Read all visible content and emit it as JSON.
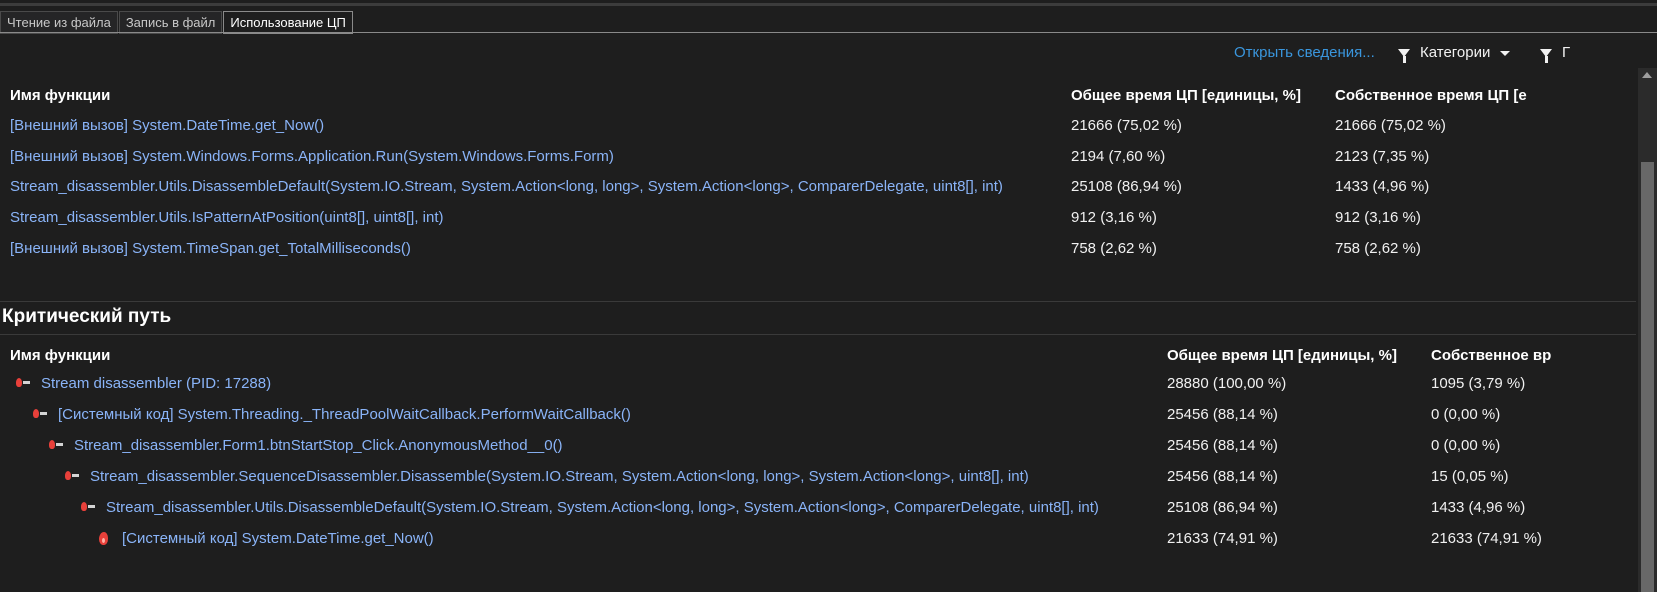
{
  "tabs": [
    {
      "label": "Чтение из файла"
    },
    {
      "label": "Запись в файл"
    },
    {
      "label": "Использование ЦП"
    }
  ],
  "toolbar": {
    "open_details": "Открыть сведения...",
    "categories": "Категории",
    "filter_partial": "Г"
  },
  "hot_functions": {
    "headers": [
      "Имя функции",
      "Общее время ЦП [единицы, %]",
      "Собственное время ЦП [е"
    ],
    "rows": [
      {
        "name": "[Внешний вызов] System.DateTime.get_Now()",
        "total": "21666 (75,02 %)",
        "self": "21666 (75,02 %)"
      },
      {
        "name": "[Внешний вызов] System.Windows.Forms.Application.Run(System.Windows.Forms.Form)",
        "total": "2194 (7,60 %)",
        "self": "2123 (7,35 %)"
      },
      {
        "name": "Stream_disassembler.Utils.DisassembleDefault(System.IO.Stream, System.Action<long, long>, System.Action<long>, ComparerDelegate, uint8[], int)",
        "total": "25108 (86,94 %)",
        "self": "1433 (4,96 %)"
      },
      {
        "name": "Stream_disassembler.Utils.IsPatternAtPosition(uint8[], uint8[], int)",
        "total": "912 (3,16 %)",
        "self": "912 (3,16 %)"
      },
      {
        "name": "[Внешний вызов] System.TimeSpan.get_TotalMilliseconds()",
        "total": "758 (2,62 %)",
        "self": "758 (2,62 %)"
      }
    ]
  },
  "critical_path": {
    "title": "Критический путь",
    "headers": [
      "Имя функции",
      "Общее время ЦП [единицы, %]",
      "Собственное вр"
    ],
    "rows": [
      {
        "name": "Stream disassembler (PID: 17288)",
        "total": "28880 (100,00 %)",
        "self": "1095 (3,79 %)",
        "icon": "hot-path-icon"
      },
      {
        "name": "[Системный код] System.Threading._ThreadPoolWaitCallback.PerformWaitCallback()",
        "total": "25456 (88,14 %)",
        "self": "0 (0,00 %)",
        "icon": "hot-path-icon"
      },
      {
        "name": "Stream_disassembler.Form1.btnStartStop_Click.AnonymousMethod__0()",
        "total": "25456 (88,14 %)",
        "self": "0 (0,00 %)",
        "icon": "hot-path-icon"
      },
      {
        "name": "Stream_disassembler.SequenceDisassembler.Disassemble(System.IO.Stream, System.Action<long, long>, System.Action<long>, uint8[], int)",
        "total": "25456 (88,14 %)",
        "self": "15 (0,05 %)",
        "icon": "hot-path-icon"
      },
      {
        "name": "Stream_disassembler.Utils.DisassembleDefault(System.IO.Stream, System.Action<long, long>, System.Action<long>, ComparerDelegate, uint8[], int)",
        "total": "25108 (86,94 %)",
        "self": "1433 (4,96 %)",
        "icon": "hot-path-icon"
      },
      {
        "name": "[Системный код] System.DateTime.get_Now()",
        "total": "21633 (74,91 %)",
        "self": "21633 (74,91 %)",
        "icon": "hot-spot-flame-icon"
      }
    ]
  },
  "colors": {
    "background": "#1e1e1e",
    "link": "#3a96dd",
    "function_name": "#8ab4f8",
    "flame": "#e8403a"
  }
}
